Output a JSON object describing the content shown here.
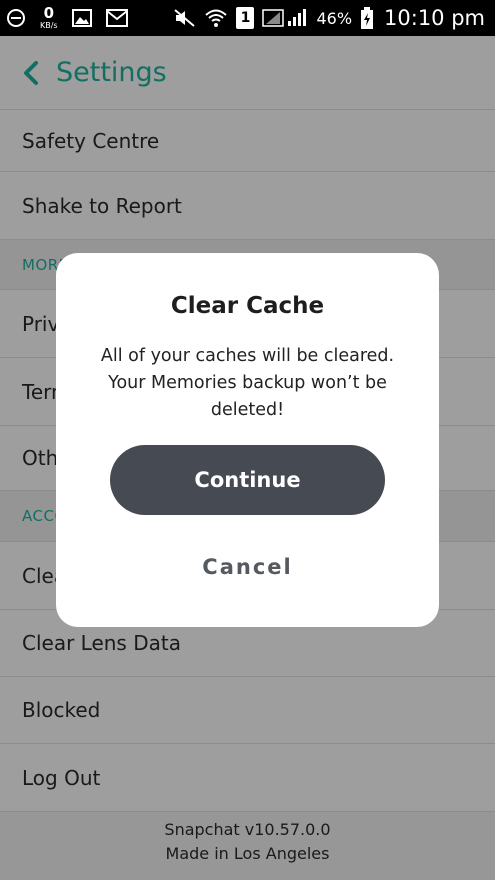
{
  "status_bar": {
    "net_speed_value": "0",
    "net_speed_unit": "KB/s",
    "battery_percent": "46%",
    "time": "10:10 pm",
    "sim_label": "1"
  },
  "header": {
    "title": "Settings",
    "accent_color": "#20b2a0"
  },
  "list": {
    "rows": [
      {
        "label": "Safety Centre"
      },
      {
        "label": "Shake to Report"
      },
      {
        "section": "MORE"
      },
      {
        "label": "Privacy Policy"
      },
      {
        "label": "Terms of Service"
      },
      {
        "label": "Other Legal"
      },
      {
        "section": "ACCOUNT ACTIONS"
      },
      {
        "label": "Clear Cache"
      },
      {
        "label": "Clear Lens Data"
      },
      {
        "label": "Blocked"
      },
      {
        "label": "Log Out"
      }
    ]
  },
  "footer": {
    "version": "Snapchat v10.57.0.0",
    "made_in": "Made in Los Angeles"
  },
  "dialog": {
    "title": "Clear Cache",
    "message": "All of your caches will be cleared. Your Memories backup won’t be deleted!",
    "continue_label": "Continue",
    "cancel_label": "Cancel",
    "continue_color": "#454a53"
  }
}
